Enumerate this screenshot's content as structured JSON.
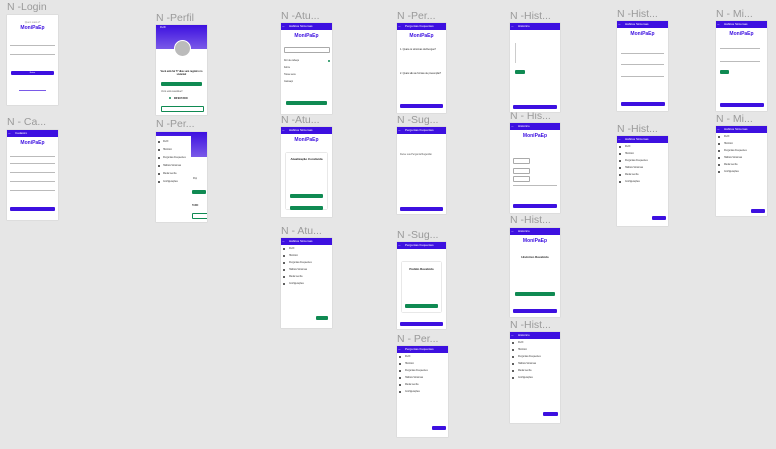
{
  "labels": {
    "login": "N -Login",
    "perfil": "N -Perfil",
    "atu1": "N -Atu...",
    "per1": "N -Per...",
    "hist1": "N -Hist...",
    "hist2": "N -Hist...",
    "mi1": "N - Mi...",
    "cadastro": "N - Ca...",
    "per2": "N -Per...",
    "atu2": "N -Atu...",
    "sug1": "N -Sug...",
    "his3": "N - His...",
    "hist4": "N -Hist...",
    "mi2": "N - Mi...",
    "atu3": "N - Atu...",
    "sug2": "N -Sug...",
    "hist5": "N -Hist...",
    "per3": "N - Per...",
    "hist6": "N -Hist..."
  },
  "app": {
    "logo": "MoniPaEp",
    "login_question": "Quem você é?",
    "login_button": "Entrar",
    "cadastro_title": "Cadastro",
    "cadastro_button": "Cadastrar",
    "perfil_title": "Perfil",
    "perfil_headline": "Você está há 7? dias sem registro no sistema!",
    "perfil_status": "Você está saudável!",
    "perfil_badge": "INFECTADO",
    "health_title": "Hábitos Sintomas",
    "health_button": "Atualizar Sintomas",
    "search_placeholder": "Pesquisar",
    "symptoms": [
      "Dor de cabeça",
      "Febre",
      "Tosse seca",
      "Cansaço"
    ],
    "update_done_title": "Atualização Concluída",
    "ok_button": "Voltar à navegação",
    "questions_title": "Perguntas frequentes",
    "questions": [
      "1. Quais os sintomas da Dengue?",
      "2. Quais são as formas de prevenção?"
    ],
    "suggestion_title": "Perguntas frequentes",
    "suggestion_prompt": "Deixe sua Pergunta/Sugestão",
    "suggestion_button": "Enviar Sugestão",
    "sent_title": "Pedido Recebido",
    "history_title": "Histórico",
    "history_button": "Voltar",
    "received_title": "Histórico Recebido",
    "menu_items": [
      "Perfil",
      "Histórico",
      "Perguntas Frequentes",
      "Hábitos Sintomas",
      "Mudar senha",
      "Configurações"
    ],
    "menu_extra": "Pop",
    "menu_extra2": "TADO"
  }
}
